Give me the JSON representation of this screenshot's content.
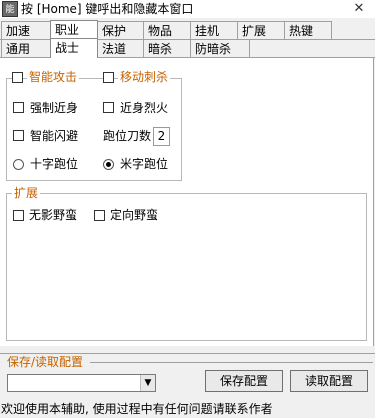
{
  "window": {
    "title": "按 [Home] 键呼出和隐藏本窗口",
    "icon_text": "能",
    "close_symbol": "✕"
  },
  "tabs_row1": [
    {
      "label": "加速",
      "selected": false
    },
    {
      "label": "职业",
      "selected": true
    },
    {
      "label": "保护",
      "selected": false
    },
    {
      "label": "物品",
      "selected": false
    },
    {
      "label": "挂机",
      "selected": false
    },
    {
      "label": "扩展",
      "selected": false
    },
    {
      "label": "热键",
      "selected": false
    }
  ],
  "tabs_row2": [
    {
      "label": "通用",
      "selected": false
    },
    {
      "label": "战士",
      "selected": true
    },
    {
      "label": "法道",
      "selected": false
    },
    {
      "label": "暗杀",
      "selected": false
    },
    {
      "label": "防暗杀",
      "selected": false
    }
  ],
  "warrior": {
    "smart_attack": {
      "label": "智能攻击",
      "checked": false
    },
    "move_stab": {
      "label": "移动刺杀",
      "checked": false
    },
    "force_melee": {
      "label": "强制近身",
      "checked": false
    },
    "melee_fire": {
      "label": "近身烈火",
      "checked": false
    },
    "smart_dodge": {
      "label": "智能闪避",
      "checked": false
    },
    "knife_count": {
      "label": "跑位刀数",
      "value": "2"
    },
    "cross_move": {
      "label": "十字跑位",
      "selected": false
    },
    "rice_move": {
      "label": "米字跑位",
      "selected": true
    }
  },
  "extension": {
    "title": "扩展",
    "no_shadow": {
      "label": "无影野蛮",
      "checked": false
    },
    "directional": {
      "label": "定向野蛮",
      "checked": false
    }
  },
  "config": {
    "title": "保存/读取配置",
    "selected": "",
    "save_label": "保存配置",
    "load_label": "读取配置",
    "dropdown_symbol": "▼"
  },
  "status": "欢迎使用本辅助, 使用过程中有任何问题请联系作者",
  "colors": {
    "group_title": "#c46200",
    "tab_selected_bg": "#ffffff",
    "window_bg": "#f0f0f0"
  }
}
